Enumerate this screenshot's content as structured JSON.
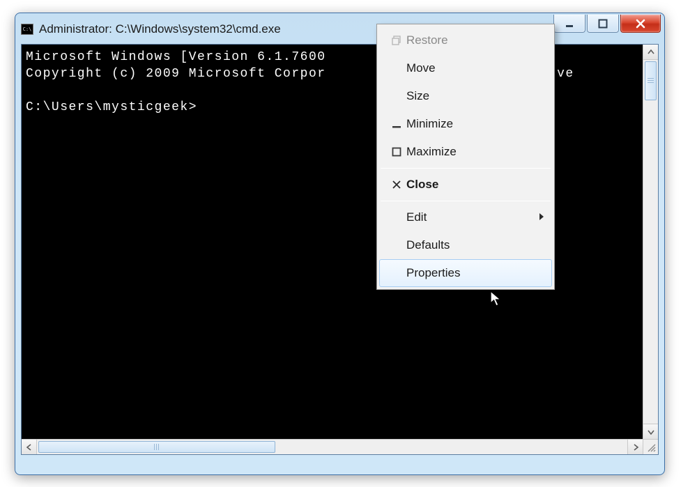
{
  "window": {
    "title": "Administrator: C:\\Windows\\system32\\cmd.exe"
  },
  "console": {
    "line1": "Microsoft Windows [Version 6.1.7600",
    "line2_left": "Copyright (c) 2009 Microsoft Corpor",
    "line2_right": "reserve",
    "prompt": "C:\\Users\\mysticgeek>"
  },
  "sysmenu": {
    "restore": "Restore",
    "move": "Move",
    "size": "Size",
    "minimize": "Minimize",
    "maximize": "Maximize",
    "close": "Close",
    "edit": "Edit",
    "defaults": "Defaults",
    "properties": "Properties"
  }
}
